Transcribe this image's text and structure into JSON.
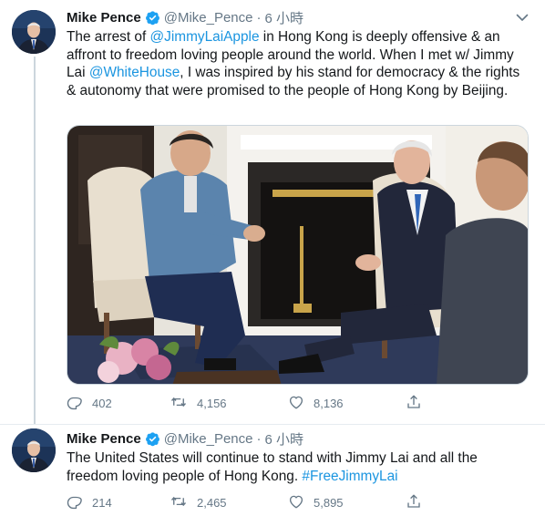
{
  "tweets": [
    {
      "author": {
        "name": "Mike Pence",
        "handle": "@Mike_Pence",
        "separator": "·",
        "time": "6 小時"
      },
      "text": {
        "p1": "The arrest of ",
        "m1": "@JimmyLaiApple",
        "p2": " in Hong Kong is deeply offensive & an affront to freedom loving people around the world. When I met w/ Jimmy Lai ",
        "m2": "@WhiteHouse",
        "p3": ", I was inspired by his stand for democracy & the rights & autonomy that were promised to the people of Hong Kong by Beijing."
      },
      "stats": {
        "replies": "402",
        "retweets": "4,156",
        "likes": "8,136"
      }
    },
    {
      "author": {
        "name": "Mike Pence",
        "handle": "@Mike_Pence",
        "separator": "·",
        "time": "6 小時"
      },
      "text": {
        "p1": "The United States will continue to stand with Jimmy Lai and all the freedom loving people of Hong Kong. ",
        "hashtag": "#FreeJimmyLai"
      },
      "stats": {
        "replies": "214",
        "retweets": "2,465",
        "likes": "5,895"
      }
    }
  ],
  "icons": {
    "verified": "verified-badge-icon",
    "menu": "chevron-down-icon",
    "reply": "reply-icon",
    "retweet": "retweet-icon",
    "like": "heart-icon",
    "share": "share-icon"
  },
  "colors": {
    "link": "#1b95e0",
    "secondary": "#657786",
    "verified": "#1da1f2",
    "text": "#14171a"
  }
}
